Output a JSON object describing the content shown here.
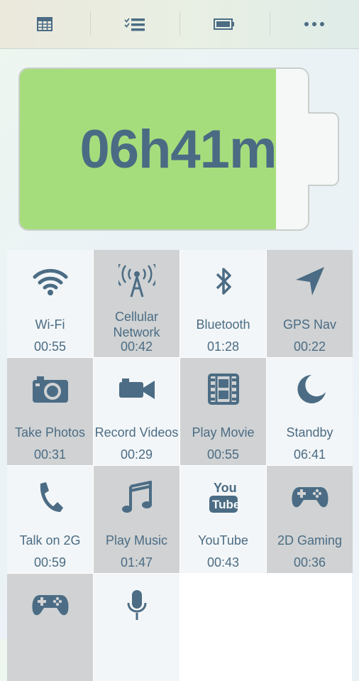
{
  "toolbar": {
    "items": [
      {
        "icon": "table-icon"
      },
      {
        "icon": "checklist-icon"
      },
      {
        "icon": "battery-icon"
      },
      {
        "icon": "more-icon"
      }
    ]
  },
  "battery": {
    "remaining": "06h41m",
    "charge_fraction": 0.89,
    "fill_color": "#a6dd7c",
    "text_color": "#4a6b83"
  },
  "activities": [
    {
      "label": "Wi-Fi",
      "time": "00:55",
      "icon": "wifi-icon"
    },
    {
      "label": "Cellular Network",
      "time": "00:42",
      "icon": "cell-tower-icon"
    },
    {
      "label": "Bluetooth",
      "time": "01:28",
      "icon": "bluetooth-icon"
    },
    {
      "label": "GPS Nav",
      "time": "00:22",
      "icon": "navigation-arrow-icon"
    },
    {
      "label": "Take Photos",
      "time": "00:31",
      "icon": "camera-icon"
    },
    {
      "label": "Record Videos",
      "time": "00:29",
      "icon": "video-camera-icon"
    },
    {
      "label": "Play Movie",
      "time": "00:55",
      "icon": "film-icon"
    },
    {
      "label": "Standby",
      "time": "06:41",
      "icon": "moon-icon"
    },
    {
      "label": "Talk on 2G",
      "time": "00:59",
      "icon": "phone-icon"
    },
    {
      "label": "Play Music",
      "time": "01:47",
      "icon": "music-note-icon"
    },
    {
      "label": "YouTube",
      "time": "00:43",
      "icon": "youtube-icon"
    },
    {
      "label": "2D Gaming",
      "time": "00:36",
      "icon": "gamepad-icon"
    },
    {
      "label": "",
      "time": "",
      "icon": "gamepad-icon"
    },
    {
      "label": "",
      "time": "",
      "icon": "microphone-icon"
    }
  ]
}
